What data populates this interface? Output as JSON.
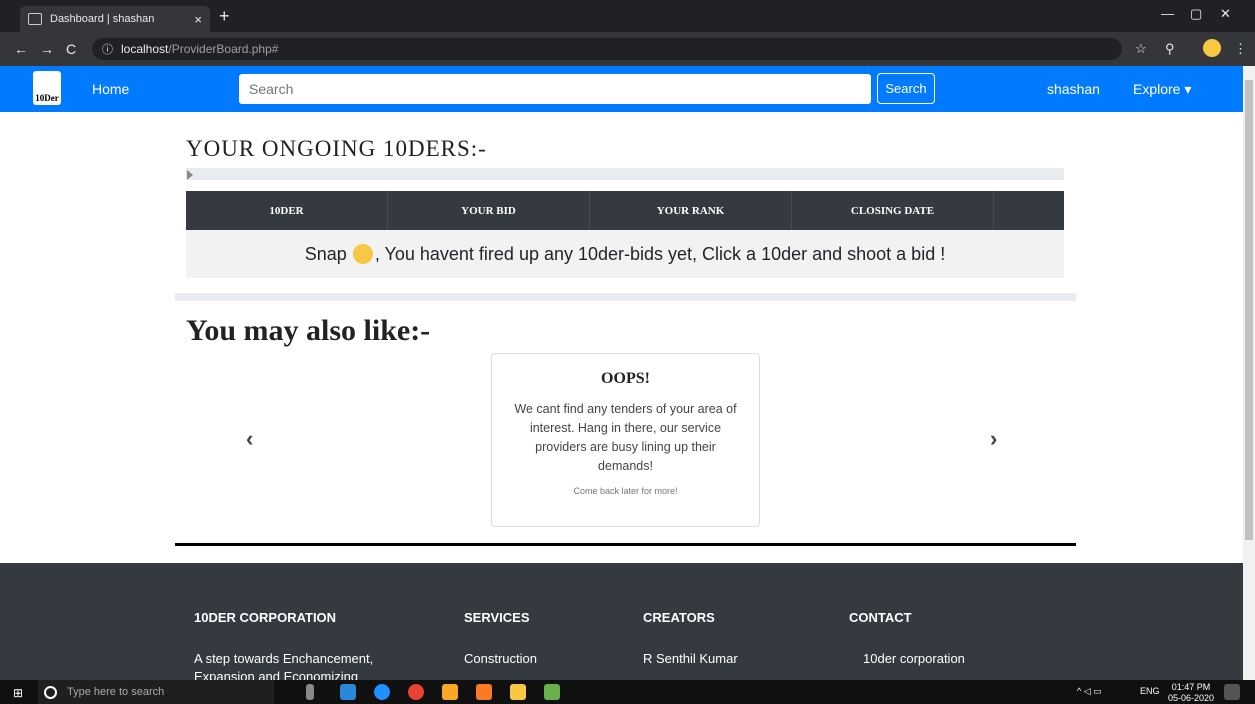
{
  "browser": {
    "tab_title": "Dashboard | shashan",
    "tab_close": "×",
    "new_tab": "+",
    "url_host": "localhost",
    "url_path": "/ProviderBoard.php#",
    "info_icon": "ⓘ",
    "back": "←",
    "forward": "→",
    "reload": "C",
    "star": "☆",
    "minimize": "—",
    "maximize": "▢",
    "close": "✕",
    "key": "⚲",
    "more": "⋮"
  },
  "navbar": {
    "logo_text": "10Der",
    "home": "Home",
    "search_placeholder": "Search",
    "search_button": "Search",
    "user": "shashan",
    "explore": "Explore ▾"
  },
  "ongoing": {
    "heading": "YOUR ONGOING 10DERS:-",
    "columns": [
      "10DER",
      "YOUR BID",
      "YOUR RANK",
      "CLOSING DATE"
    ],
    "empty_before": "Snap",
    "empty_after": ", You havent fired up any 10der-bids yet, Click a 10der and shoot a bid !"
  },
  "recommend": {
    "heading": "You may also like:-",
    "prev": "‹",
    "next": "›",
    "card_title": "OOPS!",
    "card_text": "We cant find any tenders of your area of interest. Hang in there, our service providers are busy lining up their demands!",
    "card_footer": "Come back later for more!"
  },
  "footer": {
    "columns": [
      {
        "heading": "10DER CORPORATION",
        "text": "A step towards Enchancement, Expansion and Economizing"
      },
      {
        "heading": "SERVICES",
        "text": "Construction"
      },
      {
        "heading": "CREATORS",
        "text": "R Senthil Kumar"
      },
      {
        "heading": "CONTACT",
        "text": "10der corporation"
      }
    ]
  },
  "taskbar": {
    "start": "⊞",
    "search_placeholder": "Type here to search",
    "tray_text": "ENG",
    "time": "01:47 PM",
    "date": "05-06-2020"
  }
}
